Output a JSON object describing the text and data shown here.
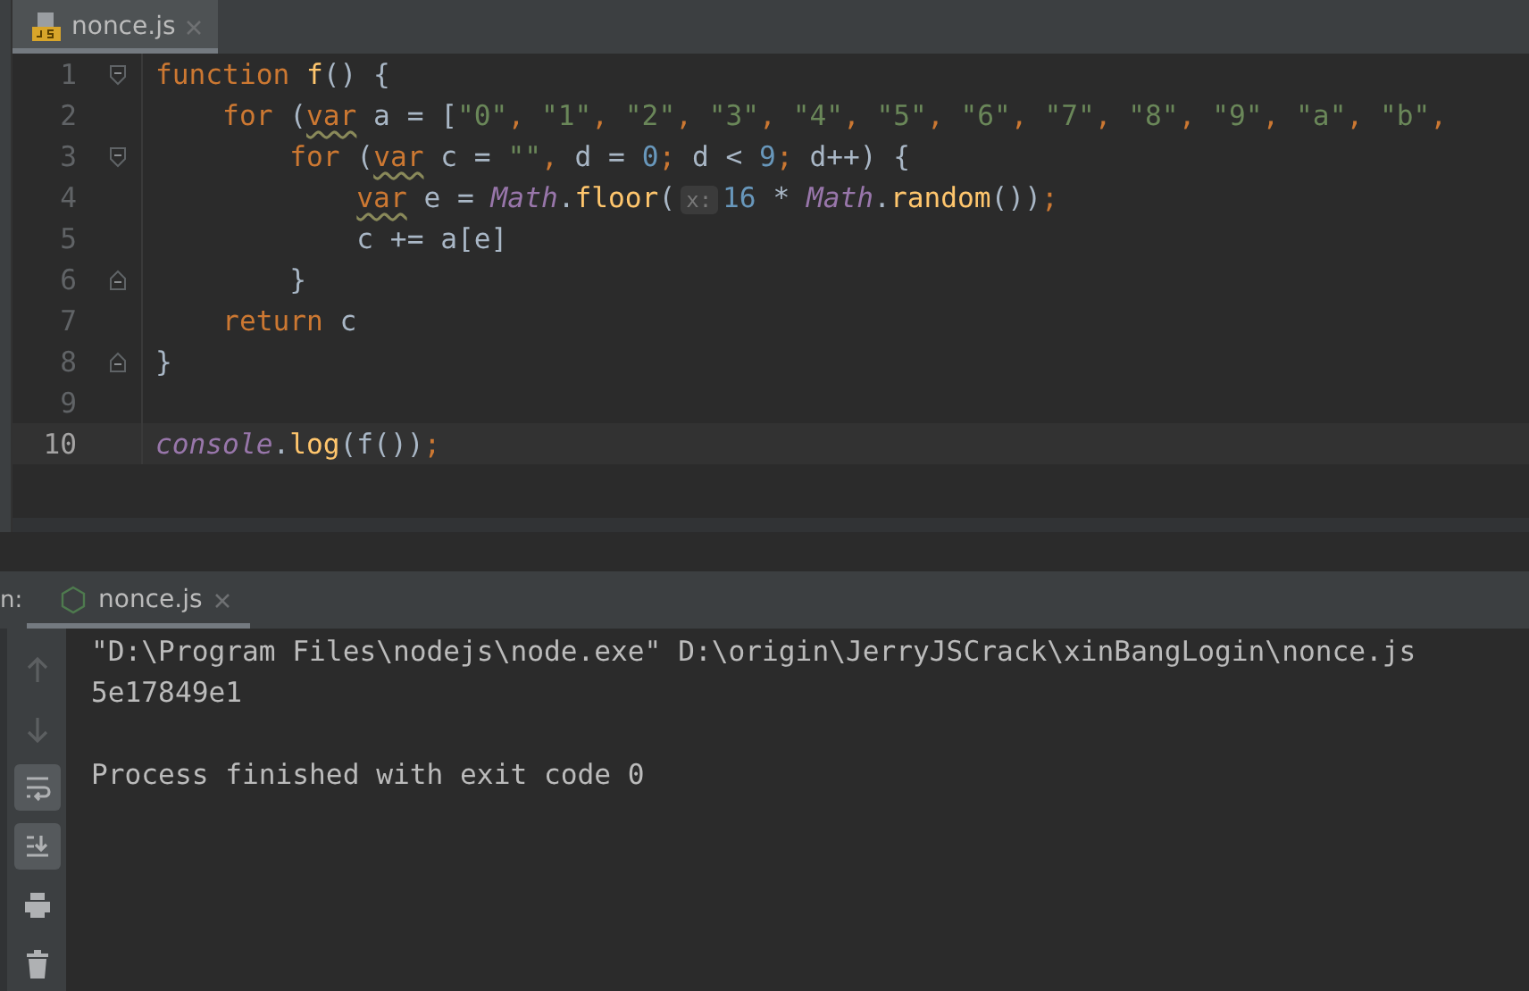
{
  "editor": {
    "tab": {
      "label": "nonce.js",
      "selected": true
    },
    "lines": [
      {
        "number": "1",
        "fold_start": true,
        "fold_end": false,
        "current": false,
        "tokens": [
          {
            "t": "function ",
            "color": "#cc7832"
          },
          {
            "t": "f",
            "color": "#ffc66d"
          },
          {
            "t": "() {",
            "color": "#a9b7c6"
          }
        ]
      },
      {
        "number": "2",
        "fold_start": false,
        "fold_end": false,
        "current": false,
        "tokens": [
          {
            "t": "    for",
            "color": "#cc7832"
          },
          {
            "t": " (",
            "color": "#a9b7c6"
          },
          {
            "t": "var",
            "color": "#cc7832",
            "warning": true
          },
          {
            "t": " a = [",
            "color": "#a9b7c6"
          },
          {
            "t": "\"0\"",
            "color": "#6a8759"
          },
          {
            "t": ", ",
            "color": "#cc7832"
          },
          {
            "t": "\"1\"",
            "color": "#6a8759"
          },
          {
            "t": ", ",
            "color": "#cc7832"
          },
          {
            "t": "\"2\"",
            "color": "#6a8759"
          },
          {
            "t": ", ",
            "color": "#cc7832"
          },
          {
            "t": "\"3\"",
            "color": "#6a8759"
          },
          {
            "t": ", ",
            "color": "#cc7832"
          },
          {
            "t": "\"4\"",
            "color": "#6a8759"
          },
          {
            "t": ", ",
            "color": "#cc7832"
          },
          {
            "t": "\"5\"",
            "color": "#6a8759"
          },
          {
            "t": ", ",
            "color": "#cc7832"
          },
          {
            "t": "\"6\"",
            "color": "#6a8759"
          },
          {
            "t": ", ",
            "color": "#cc7832"
          },
          {
            "t": "\"7\"",
            "color": "#6a8759"
          },
          {
            "t": ", ",
            "color": "#cc7832"
          },
          {
            "t": "\"8\"",
            "color": "#6a8759"
          },
          {
            "t": ", ",
            "color": "#cc7832"
          },
          {
            "t": "\"9\"",
            "color": "#6a8759"
          },
          {
            "t": ", ",
            "color": "#cc7832"
          },
          {
            "t": "\"a\"",
            "color": "#6a8759"
          },
          {
            "t": ", ",
            "color": "#cc7832"
          },
          {
            "t": "\"b\"",
            "color": "#6a8759"
          },
          {
            "t": ",",
            "color": "#cc7832"
          }
        ]
      },
      {
        "number": "3",
        "fold_start": true,
        "fold_end": false,
        "current": false,
        "tokens": [
          {
            "t": "        for",
            "color": "#cc7832"
          },
          {
            "t": " (",
            "color": "#a9b7c6"
          },
          {
            "t": "var",
            "color": "#cc7832",
            "warning": true
          },
          {
            "t": " c = ",
            "color": "#a9b7c6"
          },
          {
            "t": "\"\"",
            "color": "#6a8759"
          },
          {
            "t": ", ",
            "color": "#cc7832"
          },
          {
            "t": "d = ",
            "color": "#a9b7c6"
          },
          {
            "t": "0",
            "color": "#6897bb"
          },
          {
            "t": "; ",
            "color": "#cc7832"
          },
          {
            "t": "d < ",
            "color": "#a9b7c6"
          },
          {
            "t": "9",
            "color": "#6897bb"
          },
          {
            "t": "; ",
            "color": "#cc7832"
          },
          {
            "t": "d++) {",
            "color": "#a9b7c6"
          }
        ]
      },
      {
        "number": "4",
        "fold_start": false,
        "fold_end": false,
        "current": false,
        "tokens": [
          {
            "t": "            var",
            "color": "#cc7832",
            "warning": true
          },
          {
            "t": " e = ",
            "color": "#a9b7c6"
          },
          {
            "t": "*Math*",
            "color": "#9876aa"
          },
          {
            "t": ".",
            "color": "#a9b7c6"
          },
          {
            "t": "floor",
            "color": "#ffc66d"
          },
          {
            "t": "(",
            "color": "#a9b7c6"
          },
          {
            "t": "x:",
            "color": "#787878",
            "hint": true
          },
          {
            "t": "16",
            "color": "#6897bb"
          },
          {
            "t": " * ",
            "color": "#a9b7c6"
          },
          {
            "t": "*Math*",
            "color": "#9876aa"
          },
          {
            "t": ".",
            "color": "#a9b7c6"
          },
          {
            "t": "random",
            "color": "#ffc66d"
          },
          {
            "t": "())",
            "color": "#a9b7c6"
          },
          {
            "t": ";",
            "color": "#cc7832"
          }
        ]
      },
      {
        "number": "5",
        "fold_start": false,
        "fold_end": false,
        "current": false,
        "tokens": [
          {
            "t": "            c += a[e]",
            "color": "#a9b7c6"
          }
        ]
      },
      {
        "number": "6",
        "fold_start": false,
        "fold_end": true,
        "current": false,
        "tokens": [
          {
            "t": "        }",
            "color": "#a9b7c6"
          }
        ]
      },
      {
        "number": "7",
        "fold_start": false,
        "fold_end": false,
        "current": false,
        "tokens": [
          {
            "t": "    return",
            "color": "#cc7832"
          },
          {
            "t": " c",
            "color": "#a9b7c6"
          }
        ]
      },
      {
        "number": "8",
        "fold_start": false,
        "fold_end": true,
        "current": false,
        "tokens": [
          {
            "t": "}",
            "color": "#a9b7c6"
          }
        ]
      },
      {
        "number": "9",
        "fold_start": false,
        "fold_end": false,
        "current": false
      },
      {
        "number": "10",
        "fold_start": false,
        "fold_end": false,
        "current": true,
        "tokens": [
          {
            "t": "*console*",
            "color": "#9876aa"
          },
          {
            "t": ".",
            "color": "#a9b7c6"
          },
          {
            "t": "log",
            "color": "#ffc66d"
          },
          {
            "t": "(f())",
            "color": "#a9b7c6"
          },
          {
            "t": ";",
            "color": "#cc7832"
          }
        ]
      }
    ]
  },
  "run_panel": {
    "label": "n:",
    "tab": {
      "label": "nonce.js",
      "selected": true
    },
    "toolbar": [
      {
        "disabled": true,
        "on": false
      },
      {
        "disabled": true,
        "on": false
      },
      {
        "disabled": false,
        "on": true
      },
      {
        "disabled": false,
        "on": true
      },
      {
        "disabled": false,
        "on": false
      },
      {
        "disabled": false,
        "on": false
      }
    ],
    "console": [
      {
        "kind": "command",
        "text": "\"D:\\Program Files\\nodejs\\node.exe\" D:\\origin\\JerryJSCrack\\xinBangLogin\\nonce.js"
      },
      {
        "kind": "output",
        "text": "5e17849e1"
      },
      {
        "kind": "status",
        "text": "Process finished with exit code 0"
      }
    ]
  }
}
